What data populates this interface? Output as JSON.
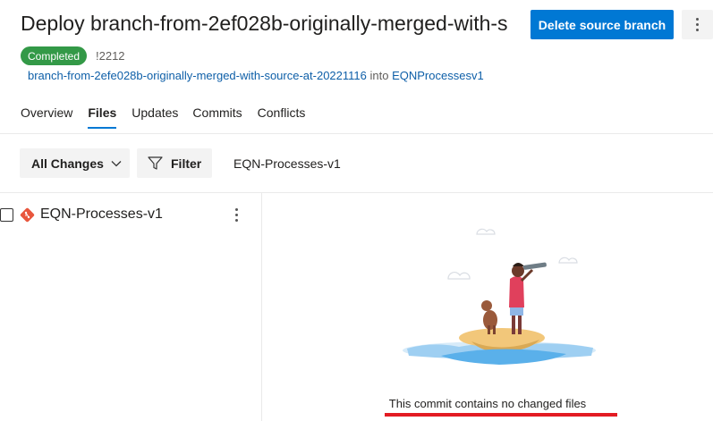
{
  "header": {
    "title": "Deploy branch-from-2ef028b-originally-merged-with-s",
    "delete_button": "Delete source branch",
    "status": "Completed",
    "pr_id": "!2212",
    "source_branch": "branch-from-2efe028b-originally-merged-with-source-at-20221116",
    "into_text": "into",
    "target_branch": "EQNProcessesv1"
  },
  "tabs": [
    {
      "label": "Overview",
      "active": false
    },
    {
      "label": "Files",
      "active": true
    },
    {
      "label": "Updates",
      "active": false
    },
    {
      "label": "Commits",
      "active": false
    },
    {
      "label": "Conflicts",
      "active": false
    }
  ],
  "toolbar": {
    "changes_dropdown": "All Changes",
    "filter_label": "Filter",
    "path": "EQN-Processes-v1"
  },
  "tree": {
    "items": [
      {
        "label": "EQN-Processes-v1",
        "icon": "git-repo-icon"
      }
    ]
  },
  "empty_state": {
    "message": "This commit contains no changed files"
  },
  "colors": {
    "primary": "#0078d4",
    "success": "#339947",
    "link": "#0e5fa8",
    "annotation": "#e31b23"
  }
}
